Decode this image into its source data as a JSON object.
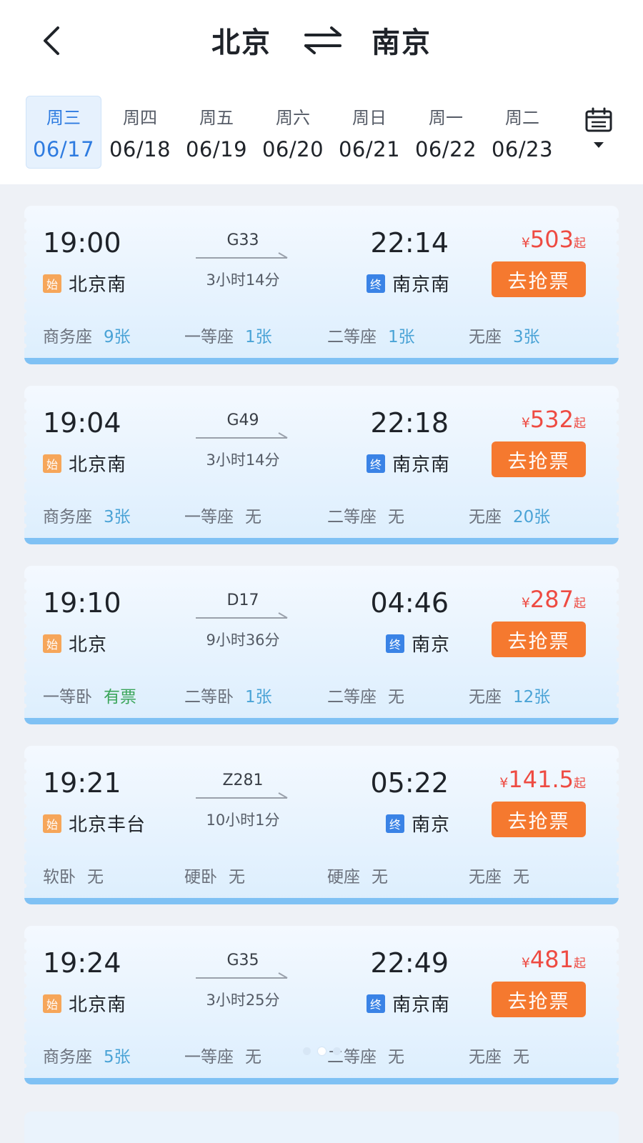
{
  "header": {
    "from_city": "北京",
    "to_city": "南京",
    "icons": {
      "back": "chevron-left-icon",
      "swap": "swap-arrows-icon",
      "calendar": "calendar-icon"
    }
  },
  "date_tabs": [
    {
      "weekday": "周三",
      "date": "06/17",
      "selected": true
    },
    {
      "weekday": "周四",
      "date": "06/18",
      "selected": false
    },
    {
      "weekday": "周五",
      "date": "06/19",
      "selected": false
    },
    {
      "weekday": "周六",
      "date": "06/20",
      "selected": false
    },
    {
      "weekday": "周日",
      "date": "06/21",
      "selected": false
    },
    {
      "weekday": "周一",
      "date": "06/22",
      "selected": false
    },
    {
      "weekday": "周二",
      "date": "06/23",
      "selected": false
    }
  ],
  "badges": {
    "start": "始",
    "end": "终"
  },
  "buttons": {
    "grab": "去抢票"
  },
  "price_labels": {
    "currency": "¥",
    "suffix": "起"
  },
  "colors": {
    "accent_blue": "#2e7be0",
    "price_red": "#ee4b42",
    "button_orange": "#f5792f",
    "seat_available": "#4aa3d6",
    "seat_has_ticket": "#3aa55a"
  },
  "trains": [
    {
      "dep_time": "19:00",
      "train_no": "G33",
      "duration": "3小时14分",
      "arr_time": "22:14",
      "dep_station": "北京南",
      "arr_station": "南京南",
      "price": "503",
      "seats": [
        {
          "name": "商务座",
          "count": "9张",
          "status": "avail"
        },
        {
          "name": "一等座",
          "count": "1张",
          "status": "avail"
        },
        {
          "name": "二等座",
          "count": "1张",
          "status": "avail"
        },
        {
          "name": "无座",
          "count": "3张",
          "status": "avail"
        }
      ]
    },
    {
      "dep_time": "19:04",
      "train_no": "G49",
      "duration": "3小时14分",
      "arr_time": "22:18",
      "dep_station": "北京南",
      "arr_station": "南京南",
      "price": "532",
      "seats": [
        {
          "name": "商务座",
          "count": "3张",
          "status": "avail"
        },
        {
          "name": "一等座",
          "count": "无",
          "status": "none"
        },
        {
          "name": "二等座",
          "count": "无",
          "status": "none"
        },
        {
          "name": "无座",
          "count": "20张",
          "status": "avail"
        }
      ]
    },
    {
      "dep_time": "19:10",
      "train_no": "D17",
      "duration": "9小时36分",
      "arr_time": "04:46",
      "dep_station": "北京",
      "arr_station": "南京",
      "price": "287",
      "seats": [
        {
          "name": "一等卧",
          "count": "有票",
          "status": "yes"
        },
        {
          "name": "二等卧",
          "count": "1张",
          "status": "avail"
        },
        {
          "name": "二等座",
          "count": "无",
          "status": "none"
        },
        {
          "name": "无座",
          "count": "12张",
          "status": "avail"
        }
      ]
    },
    {
      "dep_time": "19:21",
      "train_no": "Z281",
      "duration": "10小时1分",
      "arr_time": "05:22",
      "dep_station": "北京丰台",
      "arr_station": "南京",
      "price": "141.5",
      "seats": [
        {
          "name": "软卧",
          "count": "无",
          "status": "none"
        },
        {
          "name": "硬卧",
          "count": "无",
          "status": "none"
        },
        {
          "name": "硬座",
          "count": "无",
          "status": "none"
        },
        {
          "name": "无座",
          "count": "无",
          "status": "none"
        }
      ]
    },
    {
      "dep_time": "19:24",
      "train_no": "G35",
      "duration": "3小时25分",
      "arr_time": "22:49",
      "dep_station": "北京南",
      "arr_station": "南京南",
      "price": "481",
      "seats": [
        {
          "name": "商务座",
          "count": "5张",
          "status": "avail"
        },
        {
          "name": "一等座",
          "count": "无",
          "status": "none"
        },
        {
          "name": "二等座",
          "count": "无",
          "status": "none"
        },
        {
          "name": "无座",
          "count": "无",
          "status": "none"
        }
      ]
    }
  ]
}
